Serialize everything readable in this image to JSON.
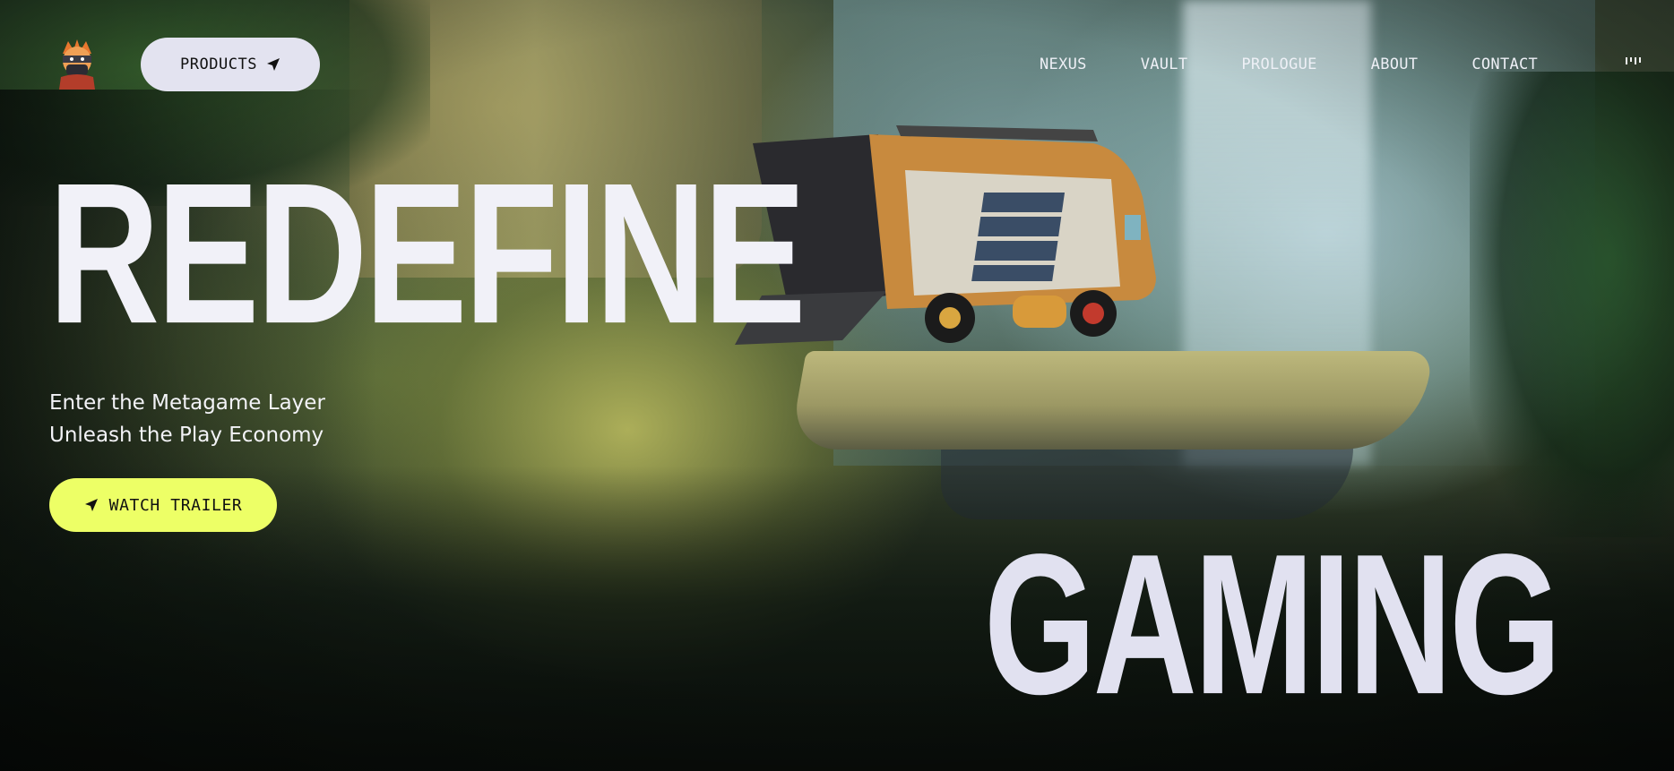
{
  "header": {
    "logo_icon": "ninja-avatar-icon",
    "products_button": {
      "label": "PRODUCTS",
      "icon": "send-arrow-icon"
    },
    "nav_links": [
      {
        "label": "NEXUS"
      },
      {
        "label": "VAULT"
      },
      {
        "label": "PROLOGUE"
      },
      {
        "label": "ABOUT"
      },
      {
        "label": "CONTACT"
      }
    ],
    "audio_toggle_icon": "audio-bars-icon"
  },
  "hero": {
    "headline_top": "REDEFINE",
    "headline_bottom": "GAMING",
    "subtitle_line1": "Enter the Metagame Layer",
    "subtitle_line2": "Unleash the Play Economy",
    "cta_button": {
      "label": "WATCH TRAILER",
      "icon": "send-arrow-icon"
    }
  },
  "colors": {
    "headline": "#f1f1f8",
    "products_button_bg": "#e3e3f0",
    "cta_button_bg": "#edff66",
    "nav_text": "#eef0f6"
  }
}
